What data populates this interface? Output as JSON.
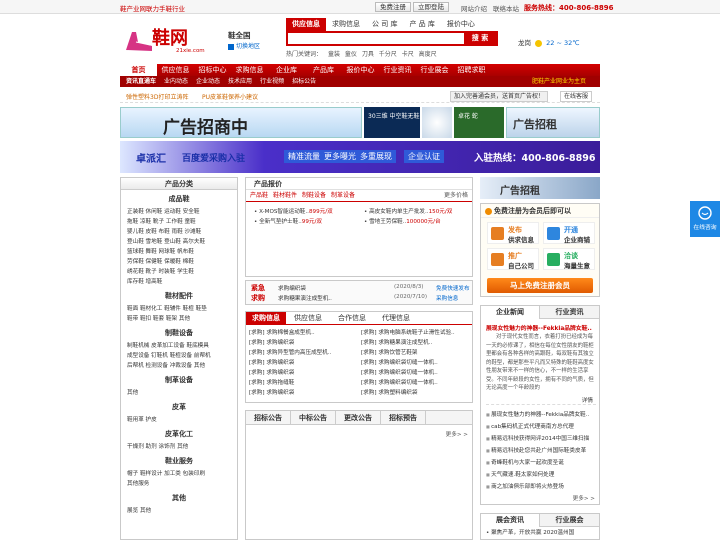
{
  "top": {
    "slogan": "鞋产业网联力手鞋行业",
    "register": "免费注册",
    "login": "立即登陆",
    "links": [
      "网站介绍",
      "联络本站"
    ],
    "hotline": "服务热线：400-806-8896"
  },
  "logo": {
    "name": "鞋网",
    "domain": "21xie.com",
    "city": "鞋全国",
    "switch": "切换地区"
  },
  "search": {
    "tabs": [
      "供应信息",
      "求购信息",
      "公 司 库",
      "产 品 库",
      "报价中心"
    ],
    "placeholder": "",
    "button": "搜 索",
    "hot_label": "热门关键词：",
    "hot": [
      "童装",
      "童仪",
      "刀具",
      "千分尺",
      "卡尺",
      "高度尺"
    ]
  },
  "weather": {
    "city": "龙岗",
    "temp": "22 ~ 32℃"
  },
  "nav": [
    "首页",
    "供应信息",
    "招标中心",
    "求购信息",
    "企业库",
    "产品库",
    "报价中心",
    "行业资讯",
    "行业展会",
    "招聘求职"
  ],
  "subnav": [
    "资讯直通车",
    "业内动态",
    "企业动态",
    "技术应用",
    "行业视频",
    "招标公告"
  ],
  "subnav_right": "肥鞋产业网业为主页",
  "notice": {
    "items": [
      "弹性塑料3D打印立涛阵",
      "PU皮革鞋保养小建议"
    ],
    "join": "加入完善通会员，送首页广告权！",
    "online": "在线客服"
  },
  "ads": {
    "banner1": "广告招商中",
    "box1": "30三维 中空鞋无鞋",
    "box3": "卓花 蛇",
    "banner_rent": "广告招租",
    "big_brand": "卓派汇",
    "big_text": "百度爱采购入驻",
    "big_tags": [
      "精准流量",
      "更多曝光",
      "多重展现",
      "企业认证"
    ],
    "big_hotline": "入驻热线：400-806-8896"
  },
  "categories": [
    {
      "title": "成品鞋",
      "rows": [
        "正装鞋 休闲鞋 运动鞋 安全鞋",
        "拖鞋 凉鞋 靴子 工作鞋 童鞋",
        "婴儿鞋 皮鞋 布鞋 雨鞋 沙滩鞋",
        "登山鞋 雪地鞋 登山鞋 高尔夫鞋",
        "篮球鞋 舞鞋 网球鞋 帆布鞋",
        "劳保鞋 保健鞋 保暖鞋 棉鞋",
        "绣花鞋 靴子 时装鞋 学生鞋",
        "库存鞋 增高鞋"
      ]
    },
    {
      "title": "鞋材配件",
      "rows": [
        "鞋面 鞋材化工 鞋辅件 鞋楦 鞋垫",
        "鞋带 鞋扣 鞋套 鞋架 其他"
      ]
    },
    {
      "title": "制鞋设备",
      "rows": [
        "制鞋机械 皮革加工设备 鞋底模具",
        "成型设备 钉鞋机 鞋楦设备 前帮机",
        "后帮机 检测设备 冲裁设备 其他"
      ]
    },
    {
      "title": "制革设备",
      "rows": [
        "其他"
      ]
    },
    {
      "title": "皮革",
      "rows": [
        "鞋用革 护皮"
      ]
    },
    {
      "title": "皮革化工",
      "rows": [
        "干燥剂 助剂 涂饰剂 其他"
      ]
    },
    {
      "title": "鞋业服务",
      "rows": [
        "帽子 鞋样设计 加工类 包装印刷",
        "其他服务"
      ]
    },
    {
      "title": "其他",
      "rows": [
        "展览 其他"
      ]
    }
  ],
  "price": {
    "title": "产品报价",
    "tabs": [
      "产品鞋",
      "鞋材鞋件",
      "制鞋设备",
      "制革设备"
    ],
    "more": "更多价格",
    "items": [
      {
        "name": "X-MOS智能运动鞋..",
        "price": "899元/双"
      },
      {
        "name": "高皮女鞋内单生产批发..",
        "price": "150元/双"
      },
      {
        "name": "全新气垫护士鞋..",
        "price": "99元/双"
      },
      {
        "name": "雪地王劳保鞋..",
        "price": "100000元/台"
      }
    ]
  },
  "urgent": {
    "label1": "紧急",
    "label2": "求购",
    "items": [
      {
        "text": "求购编织袋",
        "date": "(2020/8/3)"
      },
      {
        "text": "求购糖果演注成型机..",
        "date": "(2020/7/10)"
      }
    ],
    "link1": "免费快速发布",
    "link2": "采购信息"
  },
  "supply": {
    "tabs": [
      "求购信息",
      "供应信息",
      "合作信息",
      "代理信息"
    ],
    "left": [
      "[求购] 求购棉餐盒成型机..",
      "[求购] 求购编织袋",
      "[求购] 求购异型管内高压成型机..",
      "[求购] 求购编织袋",
      "[求购] 求购编织袋",
      "[求购] 求购拖缝鞋",
      "[求购] 求购编织袋"
    ],
    "right": [
      "[求购] 求购电脑系统鞋子止滑性试验..",
      "[求购] 求购糖果演注成型机..",
      "[求购] 求购饮管艺鞋架",
      "[求购] 求购编织袋切缝一体机..",
      "[求购] 求购编织袋切缝一体机..",
      "[求购] 求购编织袋切缝一体机..",
      "[求购] 求购塑料编织袋"
    ]
  },
  "bid": {
    "tabs": [
      "招标公告",
      "中标公告",
      "更改公告",
      "招标预告"
    ],
    "more": "更多> >"
  },
  "right": {
    "ad": "广告招租",
    "member_title": "免费注册为会员后即可以",
    "feats": [
      {
        "a": "发布",
        "b": "供求信息"
      },
      {
        "a": "开通",
        "b": "企业商铺"
      },
      {
        "a": "推广",
        "b": "自己公司"
      },
      {
        "a": "洽谈",
        "b": "海量生意"
      }
    ],
    "reg_btn": "马上免费注册会员",
    "news_tabs": [
      "企业新闻",
      "行业资讯"
    ],
    "news_head": "展现女性魅力的神器--Fekkia品牌女鞋..",
    "news_body": "对于现代女性而言，衣着打扮已经成为每一天的必修课了，相信在每位女性朋友的鞋柜里都会有各种各样的高跟鞋，每双鞋有其独立的鞋型，都是那些平凡而又特殊的鞋鞋高度女性朋友带来不一样的信心，不一样的生活享受。不同年龄段的女性，拥有不同的气质，但无论高度一个年龄段的",
    "detail": "详情",
    "news_list": [
      "展现女性魅力的神器--Fekkia品牌女鞋..",
      "cab集码机正式代理商南方总代理",
      "精易远科技获得网评2014中国三维扫描",
      "精易远科技赴您共赴广州国际鞋类皮革",
      "奇峰鞋机与大家一起欢度圣诞",
      "天气藏速.鞋太家如何处理",
      "商之加油俱乐部即将火热登场"
    ],
    "more": "更多> >",
    "expo_tabs": [
      "展会资讯",
      "行业展会"
    ],
    "expo_first": "聚焦产革，开放共赢 2020温州国"
  },
  "float": {
    "label": "在线咨询"
  }
}
